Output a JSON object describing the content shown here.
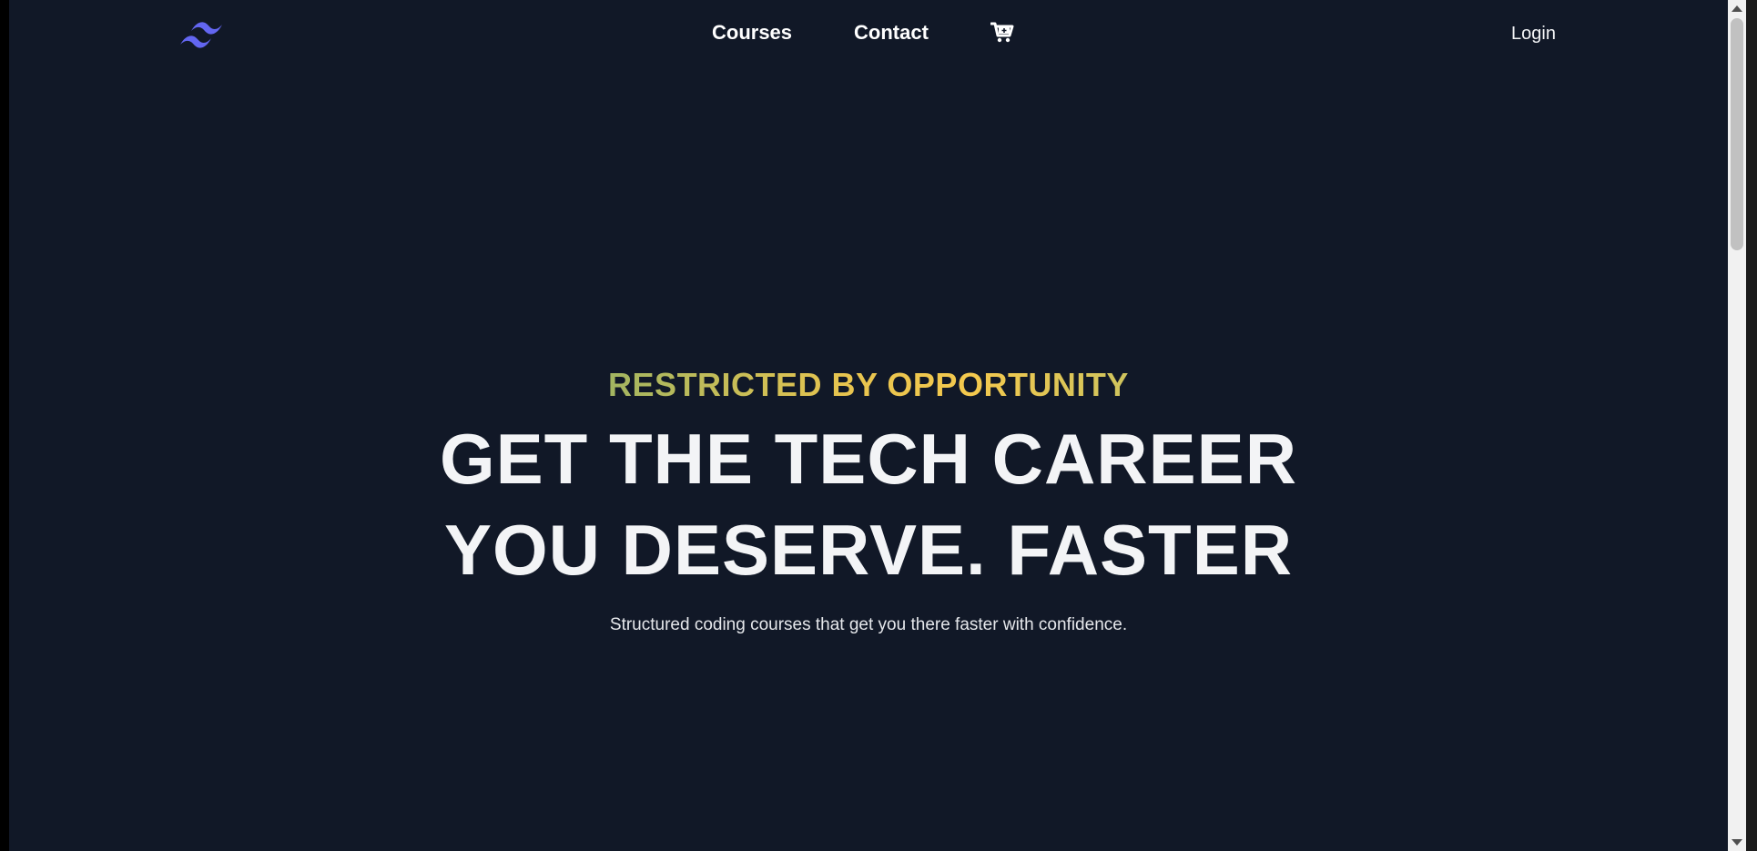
{
  "nav": {
    "logo_icon": "tailwind-wave-logo-icon",
    "links": [
      {
        "label": "Courses"
      },
      {
        "label": "Contact"
      }
    ],
    "cart_icon": "shopping-cart-icon",
    "login_label": "Login"
  },
  "hero": {
    "eyebrow": "RESTRICTED BY OPPORTUNITY",
    "headline_line1": "GET THE TECH CAREER",
    "headline_line2": "YOU DESERVE. FASTER",
    "subtitle": "Structured coding courses that get you there faster with confidence."
  },
  "colors": {
    "background": "#111827",
    "logo": "#6366f1",
    "eyebrow_gradient": [
      "#a3b561",
      "#f4c94e",
      "#cec35d"
    ],
    "text": "#f3f4f6"
  }
}
